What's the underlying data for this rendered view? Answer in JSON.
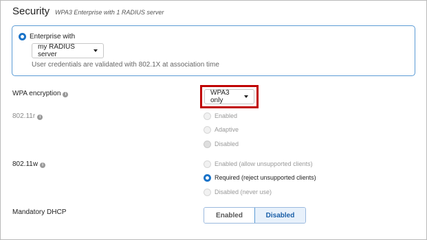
{
  "header": {
    "title": "Security",
    "subtitle": "WPA3 Enterprise with 1 RADIUS server"
  },
  "enterprise": {
    "label": "Enterprise with",
    "server_select": "my RADIUS server",
    "description": "User credentials are validated with 802.1X at association time"
  },
  "wpa_encryption": {
    "label": "WPA encryption",
    "value": "WPA3 only"
  },
  "r80211": {
    "label": "802.11r",
    "options": [
      "Enabled",
      "Adaptive",
      "Disabled"
    ],
    "selected": "Disabled"
  },
  "w80211": {
    "label": "802.11w",
    "options": [
      "Enabled (allow unsupported clients)",
      "Required (reject unsupported clients)",
      "Disabled (never use)"
    ],
    "selected": "Required (reject unsupported clients)"
  },
  "mandatory_dhcp": {
    "label": "Mandatory DHCP",
    "options": [
      "Enabled",
      "Disabled"
    ],
    "selected": "Disabled"
  },
  "colors": {
    "accent": "#1a73c8",
    "highlight_outline": "#c00000"
  }
}
